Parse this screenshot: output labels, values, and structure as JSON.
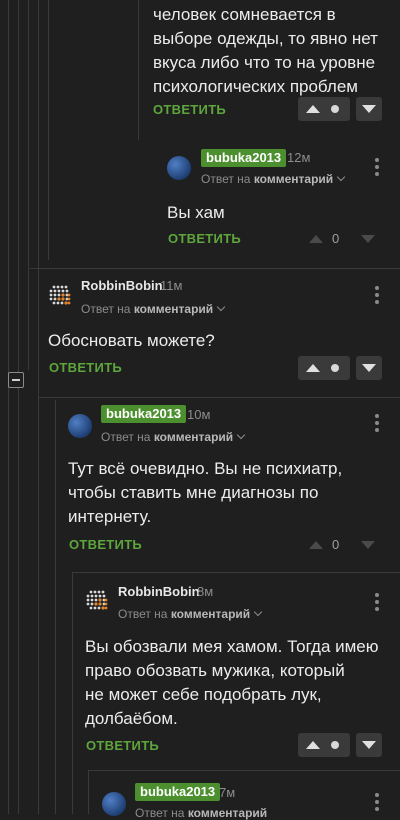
{
  "comments": [
    {
      "body_lines": [
        "человек сомневается в",
        "выборе одежды, то явно нет",
        "вкуса либо что то на уровне",
        "психологических проблем"
      ],
      "reply_label": "ОТВЕТИТЬ"
    },
    {
      "author": "bubuka2013",
      "time": "12м",
      "reply_to_prefix": "Ответ на",
      "reply_to_target": "комментарий",
      "body_lines": [
        "Вы хам"
      ],
      "reply_label": "ОТВЕТИТЬ",
      "score": "0"
    },
    {
      "author": "RobbinBobin",
      "time": "11м",
      "reply_to_prefix": "Ответ на",
      "reply_to_target": "комментарий",
      "body_lines": [
        "Обосновать можете?"
      ],
      "reply_label": "ОТВЕТИТЬ"
    },
    {
      "author": "bubuka2013",
      "time": "10м",
      "reply_to_prefix": "Ответ на",
      "reply_to_target": "комментарий",
      "body_lines": [
        "Тут всё очевидно. Вы не психиатр,",
        "чтобы ставить мне диагнозы по",
        "интернету."
      ],
      "reply_label": "ОТВЕТИТЬ",
      "score": "0"
    },
    {
      "author": "RobbinBobin",
      "time": "8м",
      "reply_to_prefix": "Ответ на",
      "reply_to_target": "комментарий",
      "body_lines": [
        "Вы обозвали мея хамом. Тогда имею",
        "право обозвать мужика, который",
        "не может себе подобрать лук,",
        "долбаёбом."
      ],
      "reply_label": "ОТВЕТИТЬ"
    },
    {
      "author": "bubuka2013",
      "time": "7м",
      "reply_to_prefix": "Ответ на",
      "reply_to_target": "комментарий"
    }
  ],
  "icons": {
    "kebab": "more-vertical-icon",
    "upvote": "triangle-up-icon",
    "downvote": "triangle-down-icon",
    "collapse": "minus-square-icon"
  },
  "colors": {
    "background": "#1f1f1f",
    "accent_green": "#5ea63b",
    "badge_green": "#4c8f2f",
    "vote_box": "#3a3a3a"
  }
}
